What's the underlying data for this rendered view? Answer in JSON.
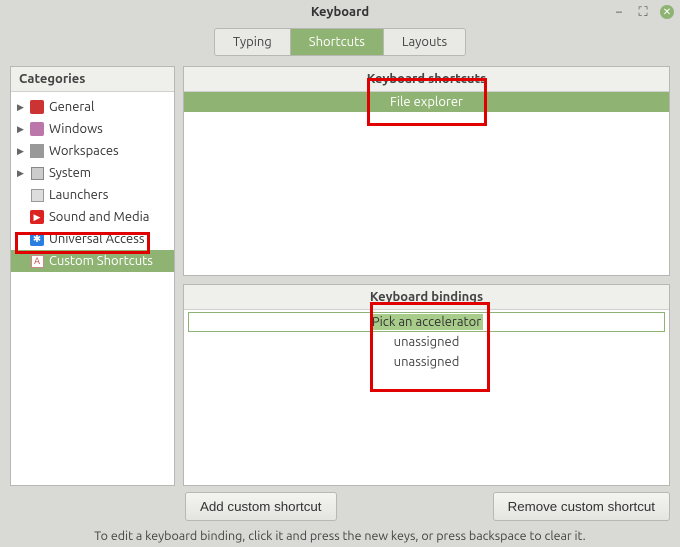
{
  "window": {
    "title": "Keyboard"
  },
  "tabs": {
    "typing": "Typing",
    "shortcuts": "Shortcuts",
    "layouts": "Layouts"
  },
  "sidebar": {
    "header": "Categories",
    "items": [
      {
        "label": "General"
      },
      {
        "label": "Windows"
      },
      {
        "label": "Workspaces"
      },
      {
        "label": "System"
      },
      {
        "label": "Launchers"
      },
      {
        "label": "Sound and Media"
      },
      {
        "label": "Universal Access"
      },
      {
        "label": "Custom Shortcuts"
      }
    ]
  },
  "shortcuts": {
    "header": "Keyboard shortcuts",
    "rows": [
      {
        "label": "File explorer"
      }
    ]
  },
  "bindings": {
    "header": "Keyboard bindings",
    "rows": [
      {
        "label": "Pick an accelerator",
        "editing": true
      },
      {
        "label": "unassigned"
      },
      {
        "label": "unassigned"
      }
    ]
  },
  "buttons": {
    "add": "Add custom shortcut",
    "remove": "Remove custom shortcut"
  },
  "hint": "To edit a keyboard binding, click it and press the new keys, or press backspace to clear it."
}
